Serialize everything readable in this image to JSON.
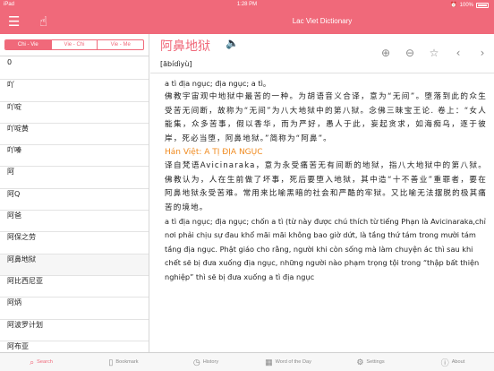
{
  "status_bar": {
    "device": "iPad",
    "time": "1:28 PM",
    "battery": "100%"
  },
  "nav": {
    "title": "Lac Viet Dictionary",
    "menu_icon": "menu-icon",
    "hand_icon": "hand-icon"
  },
  "sidebar": {
    "tabs": [
      {
        "label": "Chi - Vie",
        "active": true
      },
      {
        "label": "Vie - Chi",
        "active": false
      },
      {
        "label": "Vie - Me",
        "active": false
      }
    ],
    "words": [
      "0",
      "吖",
      "吖啶",
      "吖啶黄",
      "吖嗪",
      "阿",
      "阿Q",
      "阿爸",
      "阿保之劳",
      "阿鼻地狱",
      "阿比西尼亚",
      "阿炳",
      "阿波罗计划",
      "阿布亚"
    ],
    "selected_index": 9
  },
  "entry": {
    "headword": "阿鼻地狱",
    "phonetic": "[ābídìyù]",
    "tools": [
      "zoom-in-icon",
      "zoom-out-icon",
      "star-icon",
      "back-icon",
      "forward-icon"
    ],
    "vn_line1": "a tì địa ngục; địa ngục; a tì。",
    "cn1": "佛教宇宙观中地狱中最苦的一种。为胡语音义合译，意为“无间”。堕落到此的众生受苦无间断，故称为“无间”为八大地狱中的第八狱。念佛三昧宝王论. 卷上：“女人能集，众多苦事，假以香华，而为严好，愚人于此，妄起贪求，如海痴乌，逐于彼岸，死必当堕，阿鼻地狱。”简称为“阿鼻”。",
    "han_viet": "Hán Việt: A TỊ ĐỊA NGỤC",
    "cn2": "译自梵语Avicinaraka，意为永受痛苦无有间断的地狱，指八大地狱中的第八狱。佛教认为，人在生前做了坏事，死后要堕入地狱，其中造“十不善业”重罪者，要在阿鼻地狱永受苦难。常用来比喻黑暗的社会和严酷的牢狱。又比喻无法摆脱的极其痛苦的境地。",
    "vn_paragraph": "a tì địa ngục; địa ngục; chốn a tì (từ này được chú thích từ tiếng Phạn là Avicinaraka,chỉ nơi phải chịu sự đau khổ mãi mãi không bao giờ dứt, là tầng thứ tám trong mười tám tầng địa ngục. Phật giáo cho rằng, người khi còn sống mà làm chuyện ác thì sau khi chết sẽ bị đưa xuống địa ngục, những người nào phạm trọng tội trong “thập bất thiện nghiệp” thì sẽ bị đưa xuống a tì địa ngục"
  },
  "tabbar": {
    "items": [
      {
        "label": "Search",
        "icon": "search-icon",
        "active": true
      },
      {
        "label": "Bookmark",
        "icon": "bookmark-icon",
        "active": false
      },
      {
        "label": "History",
        "icon": "history-icon",
        "active": false
      },
      {
        "label": "Word of the Day",
        "icon": "calendar-icon",
        "active": false
      },
      {
        "label": "Settings",
        "icon": "gear-icon",
        "active": false
      },
      {
        "label": "About",
        "icon": "info-icon",
        "active": false
      }
    ]
  },
  "colors": {
    "accent": "#f0697a",
    "han_viet": "#f08a1e"
  }
}
